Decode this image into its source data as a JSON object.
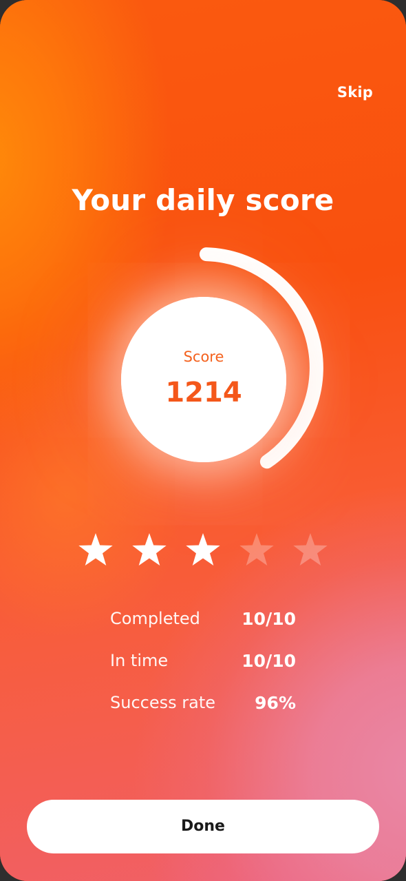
{
  "header": {
    "skip_label": "Skip"
  },
  "title": "Your daily score",
  "score": {
    "label": "Score",
    "value": "1214",
    "ring_progress": 0.4
  },
  "rating": {
    "filled": 3,
    "total": 5
  },
  "stats": [
    {
      "label": "Completed",
      "value": "10/10"
    },
    {
      "label": "In time",
      "value": "10/10"
    },
    {
      "label": "Success rate",
      "value": "96%"
    }
  ],
  "done_label": "Done",
  "colors": {
    "accent": "#f9520f",
    "score_text": "#f4571a",
    "button_bg": "#ffffff"
  }
}
